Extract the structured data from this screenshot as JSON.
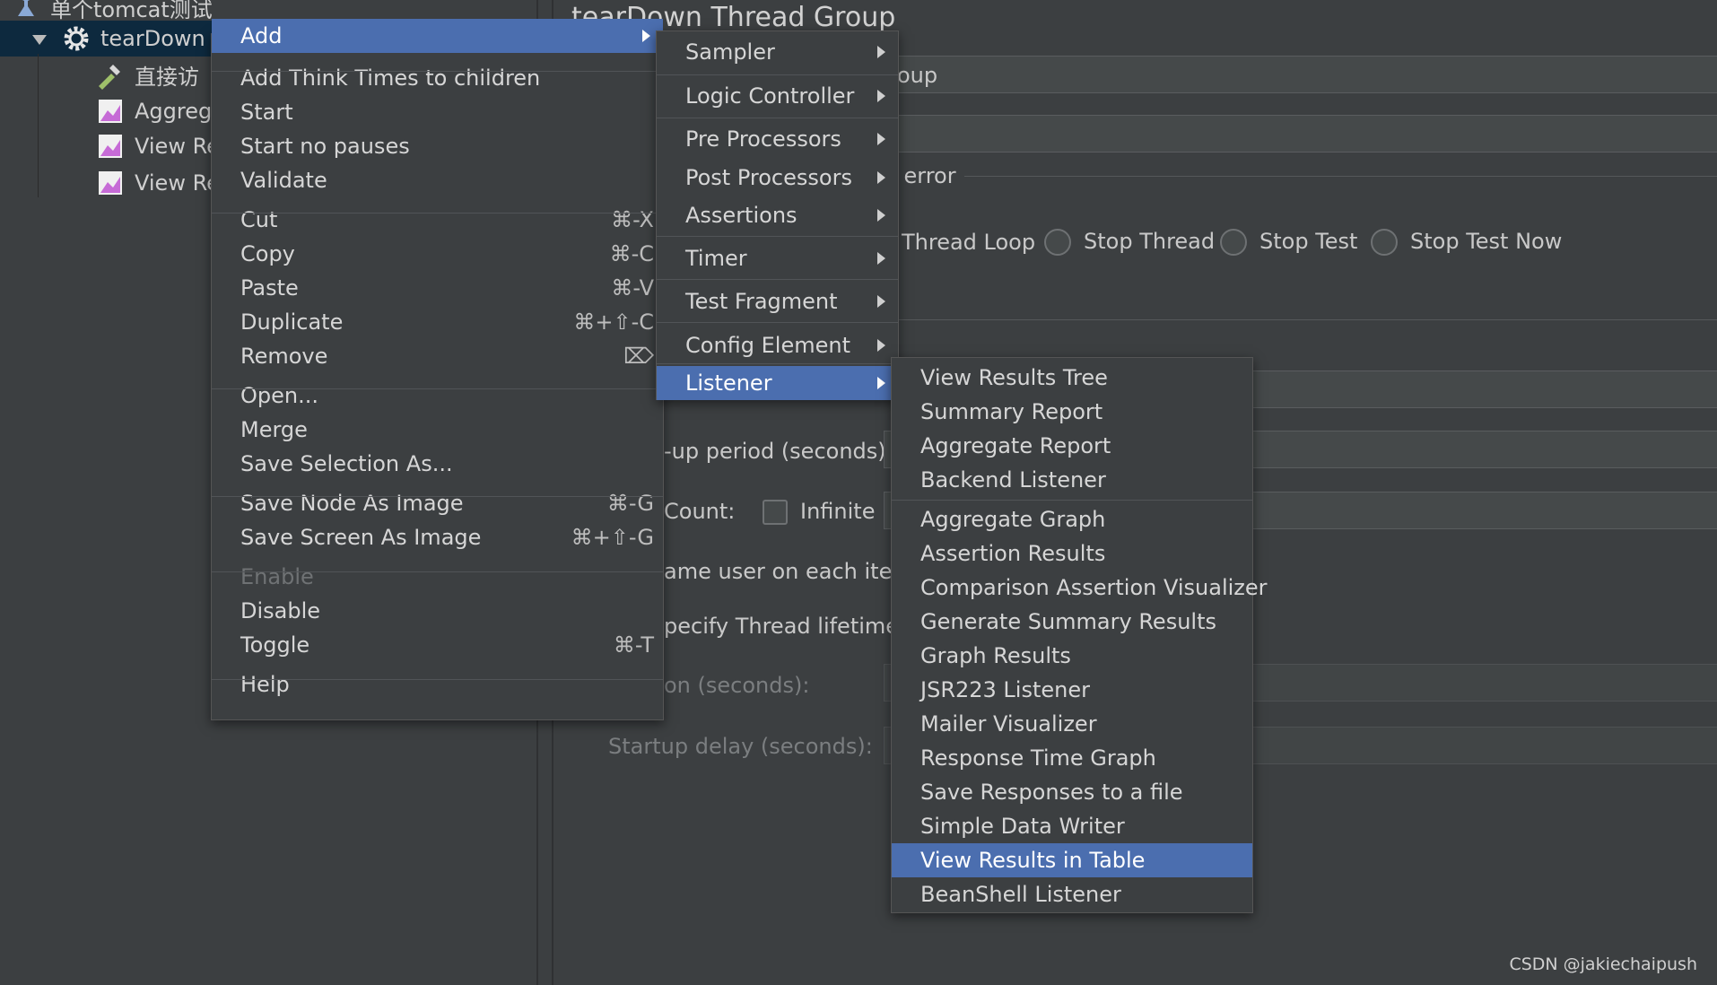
{
  "tree": {
    "root_label": "单个tomcat测试",
    "selected_label": "tearDown T",
    "children": [
      "直接访",
      "Aggreg",
      "View Re",
      "View Re"
    ]
  },
  "panel": {
    "title": "tearDown Thread Group",
    "name_field_value": "oup",
    "error_label": "r error",
    "radio_options": [
      "Thread Loop",
      "Stop Thread",
      "Stop Test",
      "Stop Test Now"
    ],
    "rampup_label": "-up period (seconds):",
    "count_label": "Count:",
    "infinite_label": "Infinite",
    "same_user_label": "ame user on each iterat",
    "specify_lifetime_label": "pecify Thread lifetime",
    "duration_label": "on (seconds):",
    "startup_delay_label": "Startup delay (seconds):"
  },
  "context_menu": {
    "items": [
      {
        "label": "Add",
        "shortcut": "",
        "submenu": true,
        "highlighted": true
      },
      {
        "label": "Add Think Times to children",
        "shortcut": ""
      },
      {
        "label": "Start",
        "shortcut": ""
      },
      {
        "label": "Start no pauses",
        "shortcut": ""
      },
      {
        "label": "Validate",
        "shortcut": ""
      },
      {
        "label": "Cut",
        "shortcut": "⌘-X"
      },
      {
        "label": "Copy",
        "shortcut": "⌘-C"
      },
      {
        "label": "Paste",
        "shortcut": "⌘-V"
      },
      {
        "label": "Duplicate",
        "shortcut": "⌘+⇧-C"
      },
      {
        "label": "Remove",
        "shortcut": "⌦"
      },
      {
        "label": "Open...",
        "shortcut": ""
      },
      {
        "label": "Merge",
        "shortcut": ""
      },
      {
        "label": "Save Selection As...",
        "shortcut": ""
      },
      {
        "label": "Save Node As Image",
        "shortcut": "⌘-G"
      },
      {
        "label": "Save Screen As Image",
        "shortcut": "⌘+⇧-G"
      },
      {
        "label": "Enable",
        "shortcut": "",
        "disabled": true
      },
      {
        "label": "Disable",
        "shortcut": ""
      },
      {
        "label": "Toggle",
        "shortcut": "⌘-T"
      },
      {
        "label": "Help",
        "shortcut": ""
      }
    ]
  },
  "add_submenu": {
    "items": [
      "Sampler",
      "Logic Controller",
      "Pre Processors",
      "Post Processors",
      "Assertions",
      "Timer",
      "Test Fragment",
      "Config Element",
      "Listener"
    ],
    "highlighted": "Listener"
  },
  "listener_submenu": {
    "items": [
      "View Results Tree",
      "Summary Report",
      "Aggregate Report",
      "Backend Listener",
      "Aggregate Graph",
      "Assertion Results",
      "Comparison Assertion Visualizer",
      "Generate Summary Results",
      "Graph Results",
      "JSR223 Listener",
      "Mailer Visualizer",
      "Response Time Graph",
      "Save Responses to a file",
      "Simple Data Writer",
      "View Results in Table",
      "BeanShell Listener"
    ],
    "highlighted": "View Results in Table"
  },
  "watermark": "CSDN @jakiechaipush",
  "colors": {
    "highlight": "#4b6eaf",
    "background": "#3c3f41"
  }
}
